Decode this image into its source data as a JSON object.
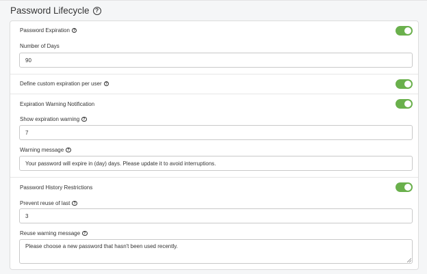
{
  "header": {
    "title": "Password Lifecycle"
  },
  "expiration": {
    "label": "Password Expiration",
    "enabled": true,
    "days_label": "Number of Days",
    "days_value": "90"
  },
  "custom_expiration": {
    "label": "Define custom expiration per user",
    "enabled": true
  },
  "warning": {
    "label": "Expiration Warning Notification",
    "enabled": true,
    "show_label": "Show expiration warning",
    "show_value": "7",
    "message_label": "Warning message",
    "message_value": "Your password will expire in (day) days. Please update it to avoid interruptions."
  },
  "history": {
    "label": "Password History Restrictions",
    "enabled": true,
    "prevent_label": "Prevent reuse of last",
    "prevent_value": "3",
    "reuse_label": "Reuse warning message",
    "reuse_value": "Please choose a new password that hasn't been used recently."
  },
  "icons": {
    "help": "?"
  },
  "colors": {
    "toggle_on": "#6ab04c"
  }
}
